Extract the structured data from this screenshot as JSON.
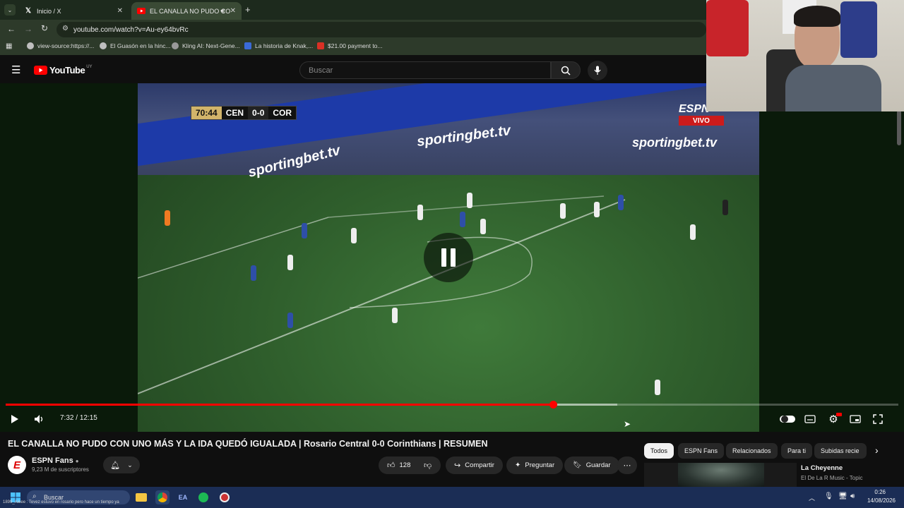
{
  "browser": {
    "tabs": [
      {
        "label": "Inicio / X",
        "icon": "x-logo-icon"
      },
      {
        "label": "EL CANALLA NO PUDO CO",
        "icon": "youtube-icon"
      }
    ],
    "url": "youtube.com/watch?v=Au-ey64bvRc",
    "bookmarks": [
      {
        "label": "view-source:https://..."
      },
      {
        "label": "El Guasón en la hinc..."
      },
      {
        "label": "Kling AI: Next-Gene..."
      },
      {
        "label": "La historia de Knak,..."
      },
      {
        "label": "$21.00 payment to..."
      }
    ]
  },
  "youtube": {
    "logo": "YouTube",
    "region": "UY",
    "search_placeholder": "Buscar"
  },
  "video": {
    "scoreboard": {
      "clock": "70:44",
      "home": "CEN",
      "score": "0-0",
      "away": "COR"
    },
    "broadcaster": "ESPN",
    "live_label": "VIVO",
    "banner_text": "sportingbet.tv",
    "current_time": "7:32",
    "duration": "12:15",
    "played_fraction": 0.613,
    "buffered_fraction": 0.685
  },
  "details": {
    "title": "EL CANALLA NO PUDO CON UNO MÁS Y LA IDA QUEDÓ IGUALADA | Rosario Central 0-0 Corinthians | RESUMEN",
    "channel": "ESPN Fans",
    "subscribers": "9,23 M de suscriptores",
    "likes": "128",
    "share_label": "Compartir",
    "ask_label": "Preguntar",
    "save_label": "Guardar"
  },
  "chips": [
    "Todos",
    "ESPN Fans",
    "Relacionados",
    "Para ti",
    "Subidas recie"
  ],
  "recommended": {
    "title": "La Cheyenne",
    "artist": "El De La R Music - Topic"
  },
  "taskbar": {
    "search": "Buscar",
    "time": "0:26",
    "date": "14/08/2026",
    "ticker": "1899_Aleee : Tevez estuvo en rosario pero hace un tiempo ya"
  },
  "colors": {
    "accent": "#ff0000",
    "taskbar": "#1b2d55"
  }
}
